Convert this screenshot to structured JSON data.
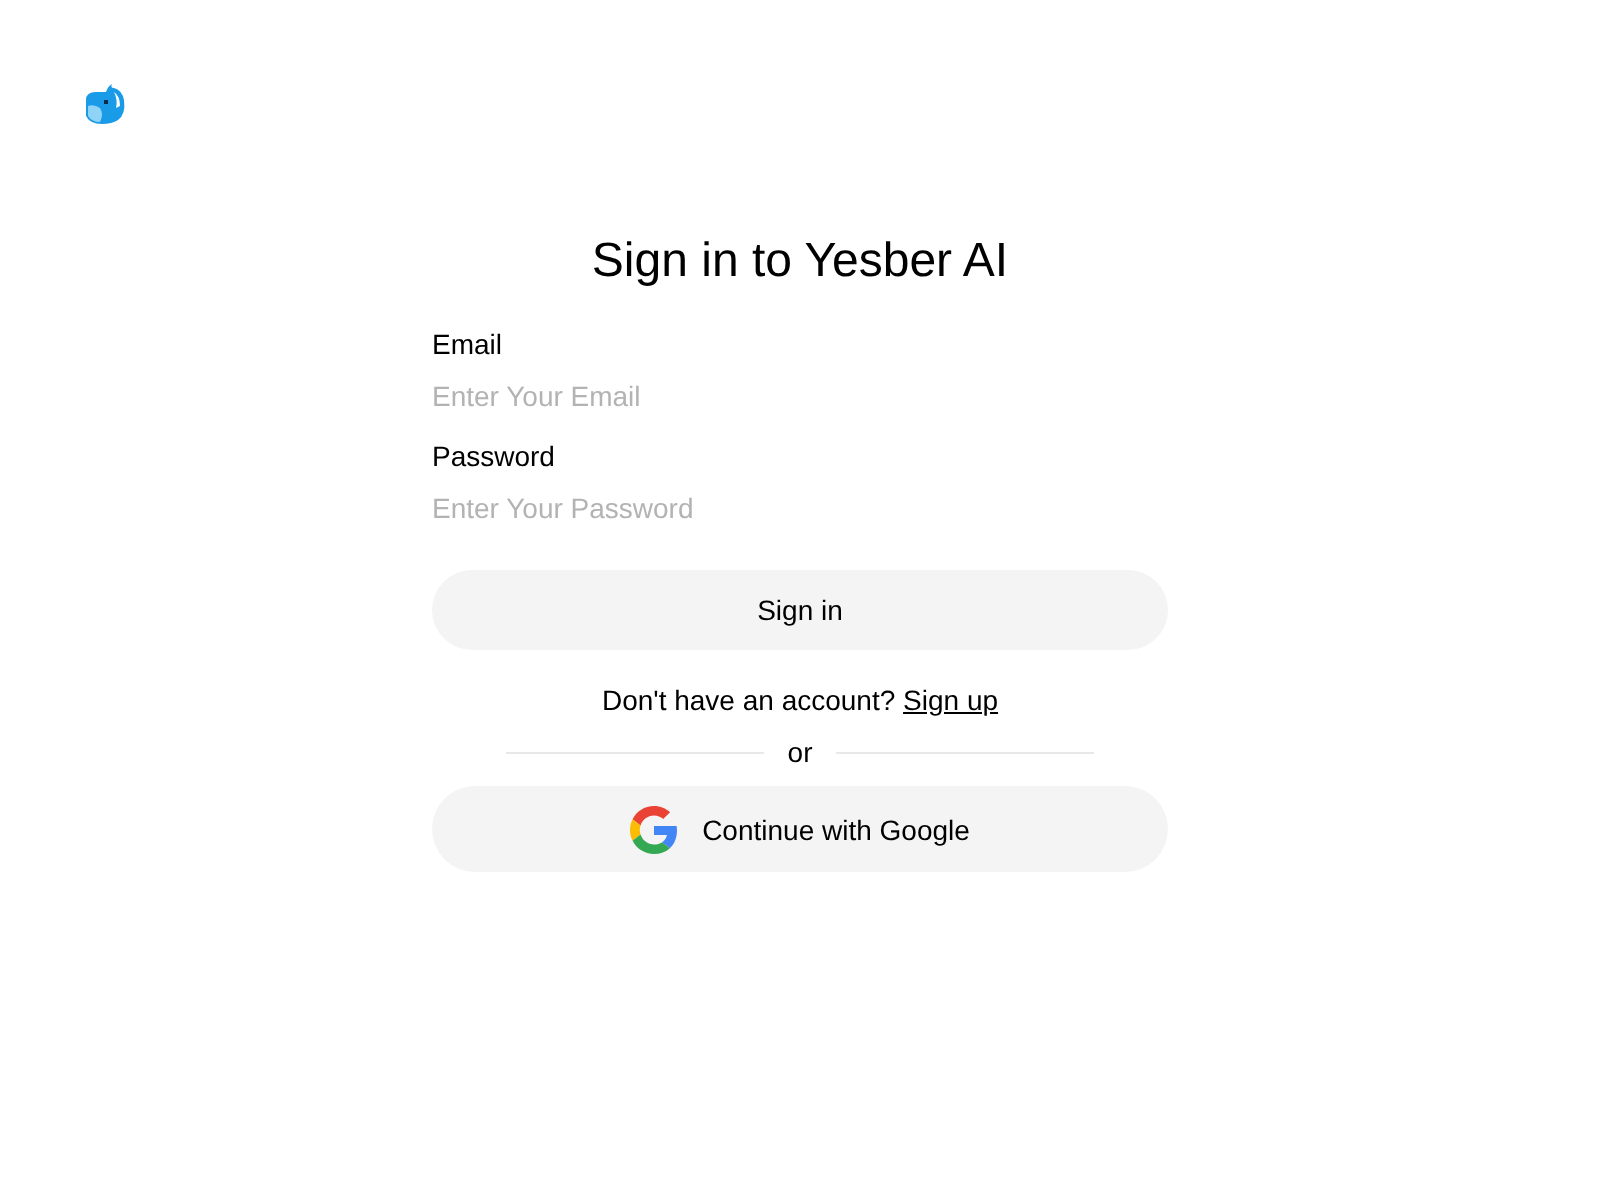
{
  "title": "Sign in to Yesber AI",
  "fields": [
    {
      "label": "Email",
      "placeholder": "Enter Your Email"
    },
    {
      "label": "Password",
      "placeholder": "Enter Your Password"
    }
  ],
  "submit": "Sign in",
  "signup": {
    "prompt": "Don't have an account?",
    "link": "Sign up"
  },
  "divider": "or",
  "google_button": "Continue with Google"
}
